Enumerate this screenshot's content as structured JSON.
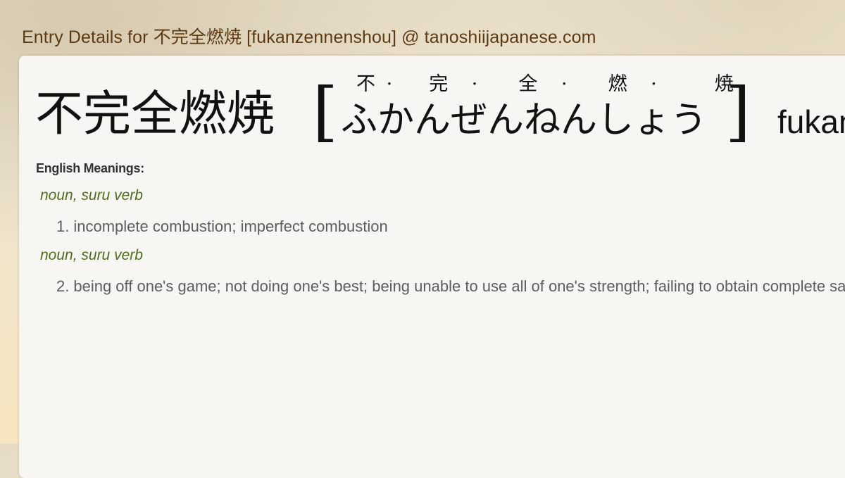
{
  "header": {
    "title": "Entry Details for 不完全燃焼 [fukanzennenshou] @ tanoshiijapanese.com"
  },
  "entry": {
    "kanji": "不完全燃焼",
    "bracket_open": "[",
    "bracket_close": "]",
    "furigana_top": [
      "不",
      "·",
      "完",
      "·",
      "全",
      "·",
      "燃",
      "·",
      "焼"
    ],
    "reading": "ふかんぜんねんしょう",
    "romaji": "fukanzennenshou"
  },
  "meanings": {
    "label": "English Meanings:",
    "senses": [
      {
        "pos": "noun, suru verb",
        "number": "1.",
        "text": "incomplete combustion; imperfect combustion"
      },
      {
        "pos": "noun, suru verb",
        "number": "2.",
        "text": "being off one's game; not doing one's best; being unable to use all of one's strength; failing to obtain complete satisfaction"
      }
    ]
  },
  "colors": {
    "header_text": "#5d3a12",
    "pos_text": "#4f6e1c",
    "meaning_text": "#5d5d5d",
    "card_bg": "#f7f6f2"
  }
}
